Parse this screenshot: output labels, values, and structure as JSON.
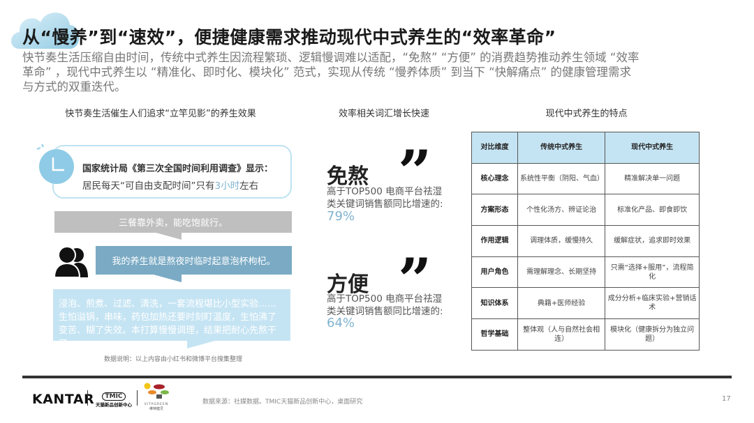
{
  "title": "从“慢养”到“速效”，便捷健康需求推动现代中式养生的“效率革命”",
  "subtitle": {
    "lines": [
      "快节奏生活压缩自由时间，传统中式养生因流程繁琐、逻辑慢调难以适配，“免熬” “方便” 的消费趋势推动养生领域 “效率",
      "革命” ，现代中式养生以 “精准化、即时化、模块化” 范式，实现从传统 “慢养体质” 到当下 “快解痛点” 的健康管理需求",
      "与方式的双重迭代。"
    ]
  },
  "left": {
    "heading": "快节奏生活催生人们追求“立竿见影”的养生效果",
    "stat_line1": "国家统计局《第三次全国时间利用调查》显示：",
    "stat_line2_pre": "居民每天“可自由支配时间”只有",
    "stat_highlight": "3小时",
    "stat_line2_post": "左右",
    "quote1": "三餐靠外卖，能吃饱就行。",
    "quote2": "我的养生就是熬夜时临时起意泡杯枸杞。",
    "quote3": "浸泡、煎煮、过滤、清洗，一套流程堪比小型实验……生怕溢锅，串味，药包加热还要时刻盯温度，生怕沸了变苦、糊了失效。本打算慢慢调理，结果把耐心先熬干了。",
    "note": "数据说明：以上内容由小红书和微博平台搜集整理"
  },
  "middle": {
    "heading": "效率相关词汇增长快速",
    "items": [
      {
        "keyword": "免熬",
        "desc1": "高于TOP500 电商平台祛湿",
        "desc2": "类关键词销售额同比增速的:",
        "value": "79%"
      },
      {
        "keyword": "方便",
        "desc1": "高于TOP500 电商平台祛湿",
        "desc2": "类关键词销售额同比增速的:",
        "value": "64%"
      }
    ]
  },
  "right": {
    "heading": "现代中式养生的特点",
    "headers": [
      "对比维度",
      "传统中式养生",
      "现代中式养生"
    ],
    "rows": [
      [
        "核心理念",
        "系统性平衡（阴阳、气血）",
        "精准解决单一问题"
      ],
      [
        "方案形态",
        "个性化汤方、辨证论治",
        "标准化产品、即食即饮"
      ],
      [
        "作用逻辑",
        "调理体质，缓慢持久",
        "缓解症状，追求即时效果"
      ],
      [
        "用户角色",
        "需理解理念、长期坚持",
        "只需“选择+服用”，流程简化"
      ],
      [
        "知识体系",
        "典籍+医师经验",
        "成分分析+临床实验+营销话术"
      ],
      [
        "哲学基础",
        "整体观（人与自然社会相连）",
        "模块化（健康拆分为独立问题）"
      ]
    ]
  },
  "footer": {
    "logos": [
      "KANTAR",
      "TMIC 天猫新品创新中心",
      "VITAGREEN 维特健灵"
    ],
    "kantar": "KANTAR",
    "tmic": "TMIC",
    "tmic_cn": "天猫新品创新中心",
    "vita": "VITAGREEN",
    "vita_cn": "维特健灵",
    "source": "数据来源：社媒数据。TMIC天猫新品创新中心，桌面研究",
    "page": "17"
  },
  "colors": {
    "accent": "#7fb3d0",
    "light_blue": "#c5e4f3",
    "gray_bubble": "#bfbfbf",
    "steel_bubble": "#7aaac4"
  }
}
